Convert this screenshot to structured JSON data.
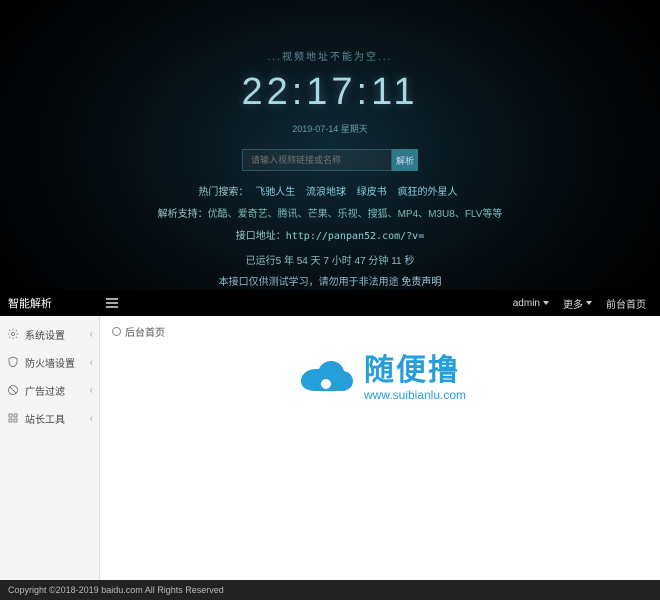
{
  "top": {
    "warn": "...视频地址不能为空...",
    "clock": "22:17:11",
    "date": "2019-07-14 星期天",
    "placeholder": "请输入视频链接或名称",
    "parse_btn": "解析",
    "hot_label": "热门搜索：",
    "hot_links": [
      "飞驰人生",
      "流浪地球",
      "绿皮书",
      "疯狂的外星人"
    ],
    "support_label": "解析支持：",
    "support_text": "优酷、爱奇艺、腾讯、芒果、乐视、搜狐、MP4、M3U8、FLV等等",
    "api_label": "接口地址：",
    "api_url": "http://panpan52.com/?v=",
    "runtime": "已运行5 年 54 天 7 小时 47 分钟 11 秒",
    "notice_a": "本接口仅供测试学习，请勿用于非法用途 ",
    "notice_b": "免责声明"
  },
  "admin": {
    "brand": "智能解析",
    "breadcrumb": "后台首页",
    "user": "admin",
    "menu_more": "更多",
    "menu_home": "前台首页",
    "sidebar": [
      {
        "label": "系统设置"
      },
      {
        "label": "防火墙设置"
      },
      {
        "label": "广告过滤"
      },
      {
        "label": "站长工具"
      }
    ],
    "watermark_cn": "随便撸",
    "watermark_en": "www.suibianlu.com",
    "footer": "Copyright ©2018-2019 baidu.com All Rights Reserved"
  }
}
